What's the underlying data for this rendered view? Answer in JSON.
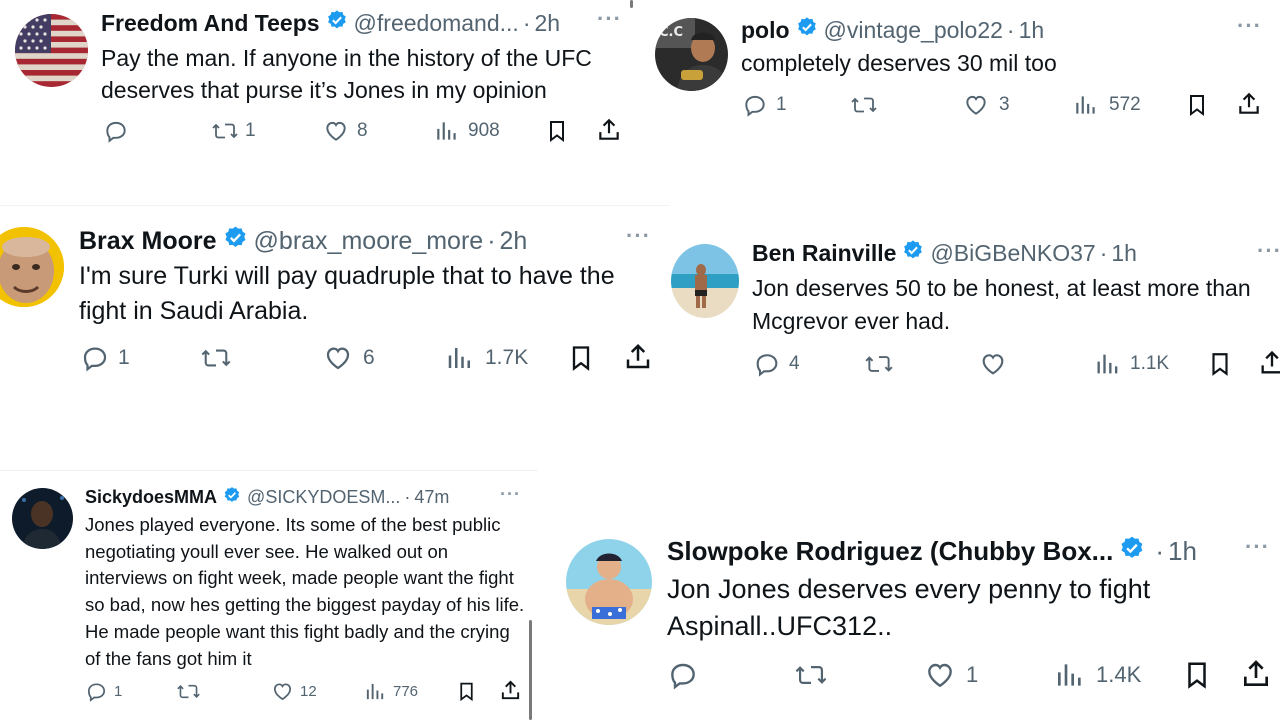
{
  "tweets": [
    {
      "name": "Freedom And Teeps",
      "handle": "@freedomand...",
      "time": "2h",
      "text": "Pay the man. If anyone in the history of the UFC deserves that purse it’s Jones in my opinion",
      "replies": "",
      "retweets": "1",
      "likes": "8",
      "views": "908",
      "avatar_icon": "usa-flag-avatar"
    },
    {
      "name": "polo",
      "handle": "@vintage_polo22",
      "time": "1h",
      "text": "completely deserves 30 mil too",
      "replies": "1",
      "retweets": "",
      "likes": "3",
      "views": "572",
      "avatar_icon": "fighter-avatar"
    },
    {
      "name": "Brax Moore",
      "handle": "@brax_moore_more",
      "time": "2h",
      "text": "I'm sure Turki will pay quadruple that to have the fight in Saudi Arabia.",
      "replies": "1",
      "retweets": "",
      "likes": "6",
      "views": "1.7K",
      "avatar_icon": "face-avatar"
    },
    {
      "name": "Ben Rainville",
      "handle": "@BiGBeNKO37",
      "time": "1h",
      "text": "Jon deserves 50 to be honest, at least more than Mcgrevor ever had.",
      "replies": "4",
      "retweets": "",
      "likes": "",
      "views": "1.1K",
      "avatar_icon": "beach-avatar"
    },
    {
      "name": "SickydoesMMA",
      "handle": "@SICKYDOESM...",
      "time": "47m",
      "text": "Jones played everyone. Its some of the best public negotiating youll ever see. He walked out on interviews on fight week, made people want the fight so bad, now hes getting the biggest payday of his life. He made people want this fight badly and the crying of the fans got him it",
      "replies": "1",
      "retweets": "",
      "likes": "12",
      "views": "776",
      "avatar_icon": "dark-portrait-avatar"
    },
    {
      "name": "Slowpoke Rodriguez (Chubby Box...",
      "handle": "",
      "time": "1h",
      "text": "Jon Jones deserves every penny to fight Aspinall..UFC312..",
      "replies": "",
      "retweets": "",
      "likes": "1",
      "views": "1.4K",
      "avatar_icon": "beach-cartoon-avatar"
    }
  ],
  "colors": {
    "text": "#0f1419",
    "secondary": "#536471",
    "verified": "#1d9bf0",
    "divider": "#eff3f4"
  },
  "misc": {
    "dot": "·",
    "more": "···"
  }
}
